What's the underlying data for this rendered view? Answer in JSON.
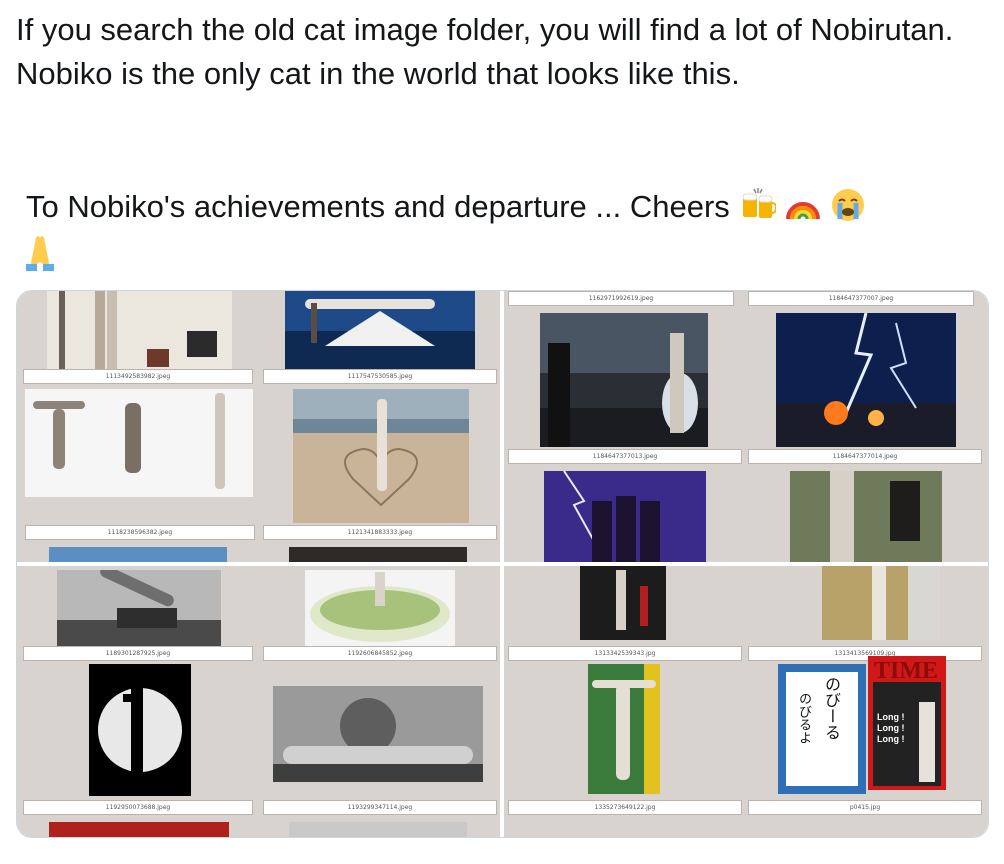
{
  "tweet": {
    "paragraph1": "If you search the old cat image folder, you will find a lot of Nobirutan. Nobiko is the only cat in the world that looks like this.",
    "paragraph2": "To Nobiko's achievements and departure ... Cheers",
    "emojis": [
      "beer-mugs-icon",
      "rainbow-icon",
      "crying-face-icon",
      "folded-hands-icon"
    ]
  },
  "media": {
    "captions": {
      "q1": [
        "1113492583982.jpeg",
        "1117547530585.jpeg",
        "1118238596382.jpeg",
        "1121341883333.jpeg"
      ],
      "q2": [
        "1162971992619.jpeg",
        "1184647377007.jpeg",
        "1184647377013.jpeg",
        "1184647377014.jpeg"
      ],
      "q3": [
        "1189301287925.jpeg",
        "1192606845852.jpeg",
        "1192950073688.jpeg",
        "1193299347114.jpeg"
      ],
      "q4": [
        "1313342539343.jpg",
        "1313413569109.jpg",
        "1335273649122.jpg",
        "p0415.jpg"
      ]
    },
    "book_cover": {
      "title": "のびーる",
      "subtitle": "のびるよ"
    },
    "magazine": {
      "brand": "TIME",
      "headline": [
        "Long !",
        "Long !",
        "Long !"
      ]
    }
  }
}
